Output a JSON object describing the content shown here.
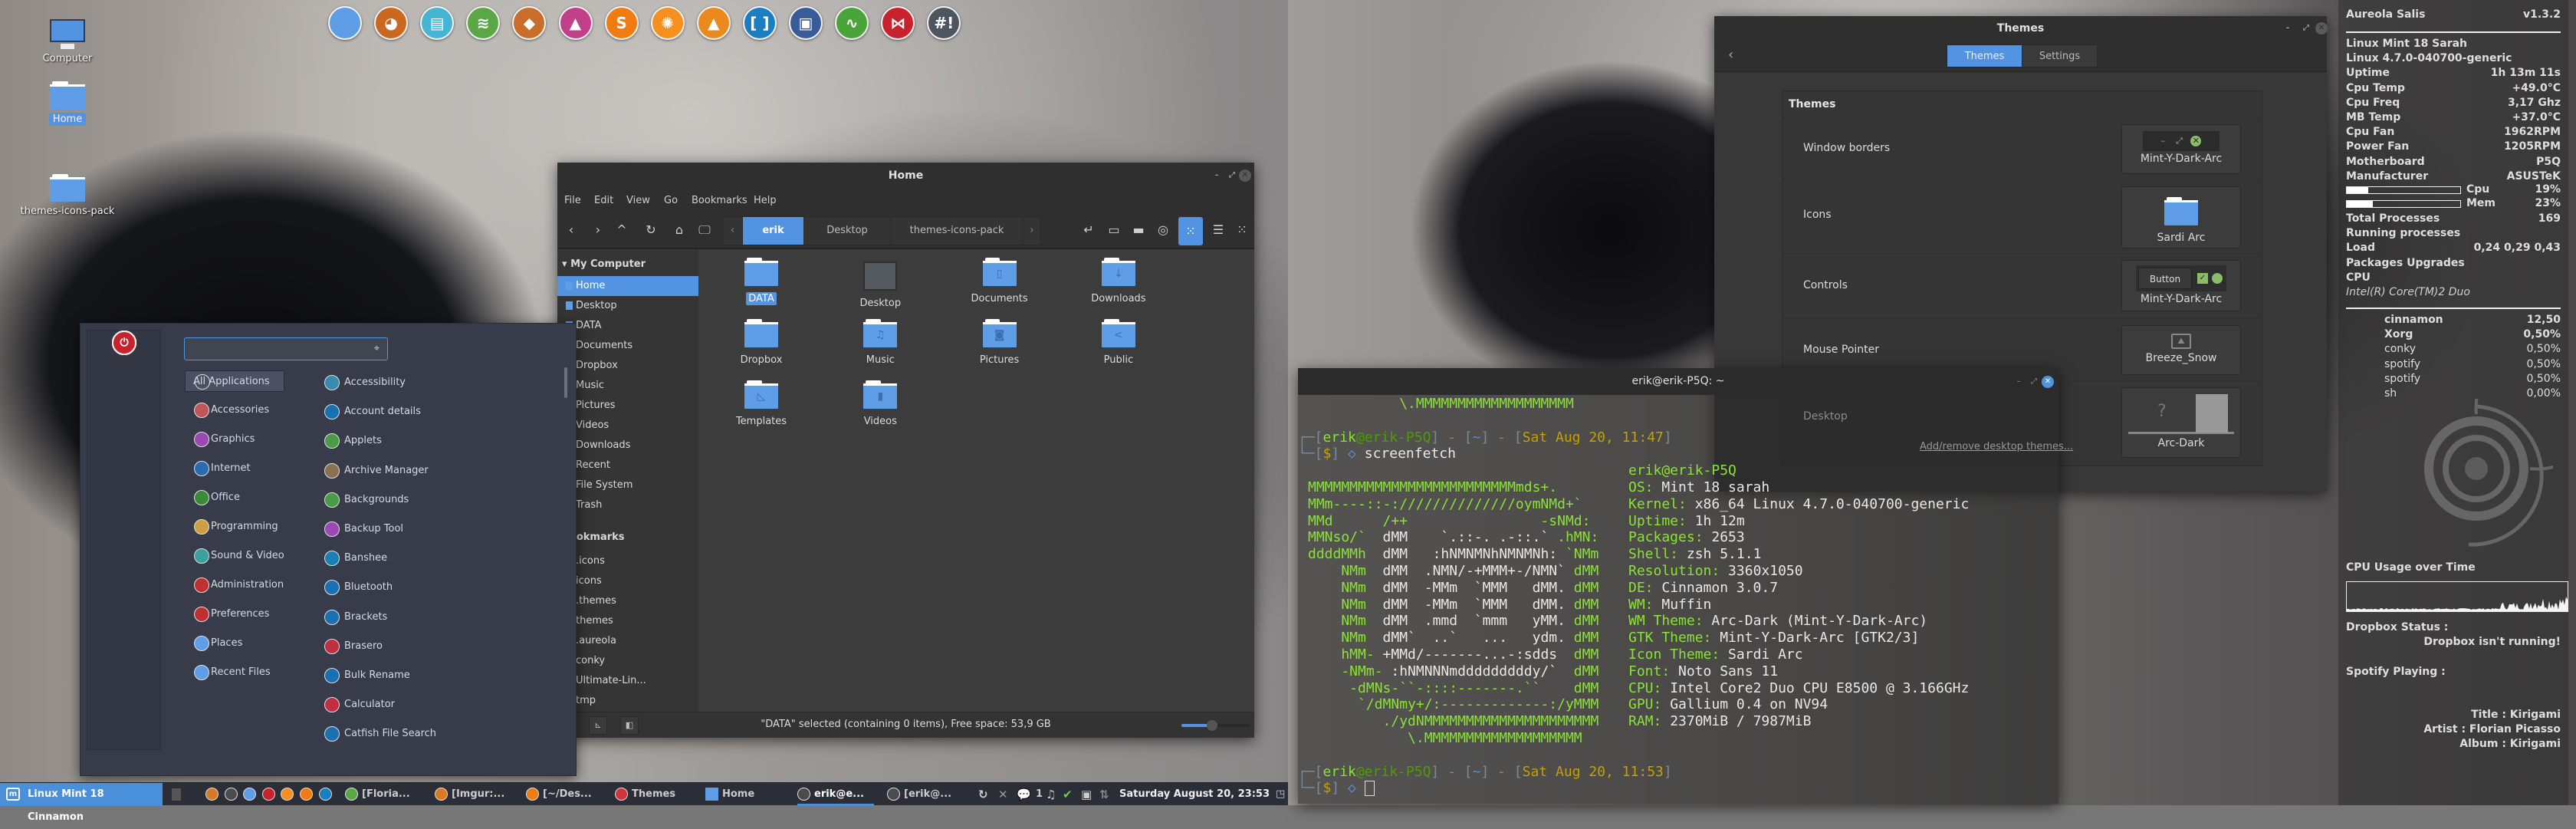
{
  "desktop": {
    "icons": [
      {
        "label": "Computer",
        "type": "computer"
      },
      {
        "label": "Home",
        "type": "folder",
        "selected": true
      },
      {
        "label": "themes-icons-pack",
        "type": "folder"
      }
    ]
  },
  "dock": {
    "icons": [
      {
        "name": "folder-icon",
        "color": "#5f9de6",
        "glyph": ""
      },
      {
        "name": "firefox-icon",
        "color": "#c9681e",
        "glyph": "◕"
      },
      {
        "name": "document-viewer-icon",
        "color": "#45b5d3",
        "glyph": "▤"
      },
      {
        "name": "spotify-icon",
        "color": "#5aa845",
        "glyph": "≋"
      },
      {
        "name": "gimp-icon",
        "color": "#c96e2a",
        "glyph": "◆"
      },
      {
        "name": "inkscape-icon",
        "color": "#c0408a",
        "glyph": "▲"
      },
      {
        "name": "sublime-text-icon",
        "color": "#f07b10",
        "glyph": "S"
      },
      {
        "name": "image-app-icon",
        "color": "#f59020",
        "glyph": "✺"
      },
      {
        "name": "vlc-icon",
        "color": "#ea8a1e",
        "glyph": "▲"
      },
      {
        "name": "brackets-icon",
        "color": "#1a7ec0",
        "glyph": "[ ]"
      },
      {
        "name": "image-viewer-icon",
        "color": "#3a5b9a",
        "glyph": "▣"
      },
      {
        "name": "system-monitor-icon",
        "color": "#4aa43a",
        "glyph": "∿"
      },
      {
        "name": "bowtie-app-icon",
        "color": "#c8232c",
        "glyph": "⋈"
      },
      {
        "name": "terminal-icon",
        "color": "#4d5660",
        "glyph": "#!"
      }
    ]
  },
  "file_manager": {
    "title": "Home",
    "menu": [
      "File",
      "Edit",
      "View",
      "Go",
      "Bookmarks",
      "Help"
    ],
    "breadcrumbs": [
      {
        "label": "erik",
        "active": true
      },
      {
        "label": "Desktop"
      },
      {
        "label": "themes-icons-pack"
      }
    ],
    "sidebar_header": "My Computer",
    "places": [
      "Home",
      "Desktop",
      "DATA",
      "Documents",
      "Dropbox",
      "Music",
      "Pictures",
      "Videos",
      "Downloads",
      "Recent",
      "File System",
      "Trash"
    ],
    "bookmarks_header": "Bookmarks",
    "bookmarks": [
      ".icons",
      "icons",
      ".themes",
      "themes",
      ".aureola",
      "conky",
      "Ultimate-Lin...",
      "tmp"
    ],
    "items": [
      {
        "label": "DATA",
        "glyph": "",
        "selected": true
      },
      {
        "label": "Desktop",
        "glyph": "",
        "kind": "desktop"
      },
      {
        "label": "Documents",
        "glyph": "▯"
      },
      {
        "label": "Downloads",
        "glyph": "↓"
      },
      {
        "label": "Dropbox",
        "glyph": ""
      },
      {
        "label": "Music",
        "glyph": "♫"
      },
      {
        "label": "Pictures",
        "glyph": "◙"
      },
      {
        "label": "Public",
        "glyph": "<"
      },
      {
        "label": "Templates",
        "glyph": "◺"
      },
      {
        "label": "Videos",
        "glyph": "▮"
      }
    ],
    "status": "\"DATA\" selected (containing 0 items), Free space: 53,9 GB",
    "zoom_level": 0.45
  },
  "menu": {
    "search_placeholder": "",
    "favorites": [
      {
        "name": "bowtie-app-icon",
        "color": "#c8232c",
        "glyph": "⋈"
      },
      {
        "name": "firefox-icon",
        "color": "#d87a22",
        "glyph": "◕"
      },
      {
        "name": "download-icon",
        "color": "#1e8a2a",
        "glyph": "⬇"
      },
      {
        "name": "admin-tool-icon",
        "color": "#cf3535",
        "glyph": "▣"
      },
      {
        "name": "terminal-icon",
        "color": "#4b4b4b",
        "glyph": "$"
      },
      {
        "name": "files-icon",
        "color": "#5f9de6",
        "glyph": ""
      },
      {
        "name": "lock-screen-icon",
        "color": "#3a9a2a",
        "glyph": "🔒"
      },
      {
        "name": "logout-icon",
        "color": "#e07b1a",
        "glyph": "↻"
      },
      {
        "name": "power-icon",
        "color": "#c8232c",
        "glyph": "⏻"
      }
    ],
    "categories": [
      {
        "label": "All Applications",
        "selected": true
      },
      {
        "label": "Accessories",
        "color": "#c0555a"
      },
      {
        "label": "Graphics",
        "color": "#9a4ab0"
      },
      {
        "label": "Internet",
        "color": "#2a6ab0"
      },
      {
        "label": "Office",
        "color": "#3a8a3a"
      },
      {
        "label": "Programming",
        "color": "#d0a040"
      },
      {
        "label": "Sound & Video",
        "color": "#3aa0a0"
      },
      {
        "label": "Administration",
        "color": "#c03030"
      },
      {
        "label": "Preferences",
        "color": "#c03030"
      },
      {
        "label": "Places",
        "color": "#5f9de6"
      },
      {
        "label": "Recent Files",
        "color": "#5f9de6"
      }
    ],
    "apps": [
      {
        "label": "Accessibility",
        "color": "#3a8ab0"
      },
      {
        "label": "Account details",
        "color": "#1a70b0"
      },
      {
        "label": "Applets",
        "color": "#4a9a4a"
      },
      {
        "label": "Archive Manager",
        "color": "#8a7050"
      },
      {
        "label": "Backgrounds",
        "color": "#4a9a4a"
      },
      {
        "label": "Backup Tool",
        "color": "#9a4ab0"
      },
      {
        "label": "Banshee",
        "color": "#1a80b0"
      },
      {
        "label": "Bluetooth",
        "color": "#1a70b0"
      },
      {
        "label": "Brackets",
        "color": "#1a70b0"
      },
      {
        "label": "Brasero",
        "color": "#c03040"
      },
      {
        "label": "Bulk Rename",
        "color": "#1a70b0"
      },
      {
        "label": "Calculator",
        "color": "#c03040"
      },
      {
        "label": "Catfish File Search",
        "color": "#1a70b0"
      }
    ]
  },
  "terminal": {
    "title": "erik@erik-P5Q: ~",
    "scrollback": "           \\.MMMMMMMMMMMMMMMMMMM",
    "prompt1": {
      "user": "erik",
      "host": "@erik-P5Q",
      "dir": "~",
      "time": "Sat Aug 20, 11:47",
      "command": "screenfetch"
    },
    "prompt2": {
      "user": "erik",
      "host": "@erik-P5Q",
      "dir": "~",
      "time": "Sat Aug 20, 11:53",
      "command": ""
    },
    "userhost": "erik@erik-P5Q",
    "art": [
      [
        [
          "MMMMMMMMMMMMMMMMMMMMMMMMMmds+.",
          "g"
        ]
      ],
      [
        [
          "MMm----::-://////////////oymNMd+`",
          "g"
        ]
      ],
      [
        [
          "MMd      /++                -sNMd:",
          "g"
        ]
      ],
      [
        [
          "MMNso/`  ",
          "g"
        ],
        [
          "dMM    `.::-. .-::.`",
          "w"
        ],
        [
          " .hMN:",
          "g"
        ]
      ],
      [
        [
          "ddddMMh  ",
          "g"
        ],
        [
          "dMM   :hNMNMNhNMNMNh:",
          "w"
        ],
        [
          " `NMm",
          "g"
        ]
      ],
      [
        [
          "    NMm  ",
          "g"
        ],
        [
          "dMM  .NMN/-+MMM+-/NMN`",
          "w"
        ],
        [
          " dMM",
          "g"
        ]
      ],
      [
        [
          "    NMm  ",
          "g"
        ],
        [
          "dMM  -MMm  `MMM   dMM.",
          "w"
        ],
        [
          " dMM",
          "g"
        ]
      ],
      [
        [
          "    NMm  ",
          "g"
        ],
        [
          "dMM  -MMm  `MMM   dMM.",
          "w"
        ],
        [
          " dMM",
          "g"
        ]
      ],
      [
        [
          "    NMm  ",
          "g"
        ],
        [
          "dMM  .mmd  `mmm   yMM.",
          "w"
        ],
        [
          " dMM",
          "g"
        ]
      ],
      [
        [
          "    NMm  ",
          "g"
        ],
        [
          "dMM`  ..`   ...   ydm.",
          "w"
        ],
        [
          " dMM",
          "g"
        ]
      ],
      [
        [
          "    hMM- ",
          "g"
        ],
        [
          "+MMd/-------...-:sdds",
          "w"
        ],
        [
          "  dMM",
          "g"
        ]
      ],
      [
        [
          "    -NMm- ",
          "g"
        ],
        [
          ":hNMNNNmdddddddddy/`",
          "w"
        ],
        [
          "  dMM",
          "g"
        ]
      ],
      [
        [
          "     -dMNs-``-::::-------.``",
          "g"
        ],
        [
          "    dMM",
          "g"
        ]
      ],
      [
        [
          "      `/dMNmy+/:-------------:/yMMM",
          "g"
        ]
      ],
      [
        [
          "         ./ydNMMMMMMMMMMMMMMMMMMMMM",
          "g"
        ]
      ],
      [
        [
          "            \\.MMMMMMMMMMMMMMMMMMM",
          "g"
        ]
      ]
    ],
    "info": [
      {
        "k": "OS:",
        "v": " Mint 18 sarah"
      },
      {
        "k": "Kernel:",
        "v": " x86_64 Linux 4.7.0-040700-generic"
      },
      {
        "k": "Uptime:",
        "v": " 1h 12m"
      },
      {
        "k": "Packages:",
        "v": " 2653"
      },
      {
        "k": "Shell:",
        "v": " zsh 5.1.1"
      },
      {
        "k": "Resolution:",
        "v": " 3360x1050"
      },
      {
        "k": "DE:",
        "v": " Cinnamon 3.0.7"
      },
      {
        "k": "WM:",
        "v": " Muffin"
      },
      {
        "k": "WM Theme:",
        "v": " Arc-Dark (Mint-Y-Dark-Arc)"
      },
      {
        "k": "GTK Theme:",
        "v": " Mint-Y-Dark-Arc [GTK2/3]"
      },
      {
        "k": "Icon Theme:",
        "v": " Sardi Arc"
      },
      {
        "k": "Font:",
        "v": " Noto Sans 11"
      },
      {
        "k": "CPU:",
        "v": " Intel Core2 Duo CPU E8500 @ 3.166GHz"
      },
      {
        "k": "GPU:",
        "v": " Gallium 0.4 on NV94"
      },
      {
        "k": "RAM:",
        "v": " 2370MiB / 7987MiB"
      }
    ]
  },
  "themes": {
    "title": "Themes",
    "tabs": [
      {
        "label": "Themes",
        "active": true
      },
      {
        "label": "Settings"
      }
    ],
    "section": "Themes",
    "rows": [
      {
        "label": "Window borders",
        "value": "Mint-Y-Dark-Arc"
      },
      {
        "label": "Icons",
        "value": "Sardi Arc"
      },
      {
        "label": "Controls",
        "value": "Mint-Y-Dark-Arc",
        "button": "Button"
      },
      {
        "label": "Mouse Pointer",
        "value": "Breeze_Snow"
      },
      {
        "label": "Desktop",
        "value": "Arc-Dark"
      }
    ],
    "add_remove_link": "Add/remove desktop themes..."
  },
  "conky": {
    "title": "Aureola Salis",
    "version": "v1.3.2",
    "rows": [
      {
        "k": "Linux Mint 18 Sarah",
        "v": ""
      },
      {
        "k": "Linux 4.7.0-040700-generic",
        "v": ""
      },
      {
        "k": "Uptime",
        "v": "1h 13m 11s"
      },
      {
        "k": "Cpu Temp",
        "v": "+49.0°C"
      },
      {
        "k": "Cpu Freq",
        "v": "3,17 Ghz"
      },
      {
        "k": "MB Temp",
        "v": "+37.0°C"
      },
      {
        "k": "Cpu Fan",
        "v": "1962RPM"
      },
      {
        "k": "Power Fan",
        "v": "1205RPM"
      },
      {
        "k": "Motherboard",
        "v": "P5Q"
      },
      {
        "k": "Manufacturer",
        "v": "ASUSTeK"
      }
    ],
    "cpu": {
      "label": "Cpu",
      "value": "19%",
      "fraction": 0.19
    },
    "mem": {
      "label": "Mem",
      "value": "23%",
      "fraction": 0.23
    },
    "rows2": [
      {
        "k": "Total Processes",
        "v": "169"
      },
      {
        "k": "Running processes",
        "v": ""
      },
      {
        "k": "Load",
        "v": "0,24 0,29 0,43"
      },
      {
        "k": "Packages Upgrades",
        "v": ""
      },
      {
        "k": "CPU",
        "v": ""
      }
    ],
    "cpu_model": "Intel(R) Core(TM)2 Duo",
    "processes": [
      {
        "name": "cinnamon",
        "v": "12,50",
        "bold": true
      },
      {
        "name": "Xorg",
        "v": "0,50%",
        "bold": true
      },
      {
        "name": "conky",
        "v": "0,50%"
      },
      {
        "name": "spotify",
        "v": "0,50%"
      },
      {
        "name": "spotify",
        "v": "0,50%"
      },
      {
        "name": "sh",
        "v": "0,00%"
      }
    ],
    "cpu_graph_label": "CPU Usage over Time",
    "dropbox_label": "Dropbox Status :",
    "dropbox_status": "Dropbox isn't running!",
    "spotify_label": "Spotify Playing :",
    "spotify_title": "Title : Kirigami",
    "spotify_artist": "Artist : Florian Picasso",
    "spotify_album": "Album : Kirigami"
  },
  "panel": {
    "menu_label": "Linux Mint 18 Cinnamon",
    "launchers": [
      {
        "name": "firefox-icon",
        "color": "#d87a22"
      },
      {
        "name": "terminal-icon",
        "color": "#4b4b4b"
      },
      {
        "name": "files-icon",
        "color": "#5f9de6"
      },
      {
        "name": "bowtie-app-icon",
        "color": "#c8232c"
      },
      {
        "name": "image-app-icon",
        "color": "#f59020"
      },
      {
        "name": "sublime-text-icon",
        "color": "#f07b10"
      },
      {
        "name": "brackets-icon",
        "color": "#1a7ec0"
      }
    ],
    "windows": [
      {
        "label": "[Floria...",
        "color": "#5aa845"
      },
      {
        "label": "[Imgur:...",
        "color": "#d87a22"
      },
      {
        "label": "[~/Des...",
        "color": "#f07b10"
      },
      {
        "label": "Themes",
        "color": "#cf3535"
      },
      {
        "label": "Home",
        "color": "#5f9de6"
      },
      {
        "label": "erik@e...",
        "color": "#4b4b4b",
        "active": true
      },
      {
        "label": "[erik@...",
        "color": "#4b4b4b"
      }
    ],
    "notification_count": "1",
    "clock": "Saturday August 20, 23:53"
  }
}
